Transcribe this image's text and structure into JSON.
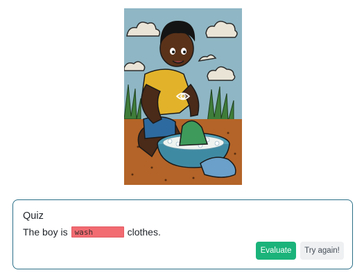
{
  "illustration": {
    "subject": "boy washing clothes in a basin",
    "overlay_icon": "eye-icon"
  },
  "quiz": {
    "title": "Quiz",
    "sentence_before": "The boy is",
    "answer_value": "wash",
    "sentence_after": "clothes.",
    "answer_state_color": "#f16b71",
    "evaluate_label": "Evaluate",
    "try_again_label": "Try again!",
    "accent_color": "#1bb37a",
    "border_color": "#2a6f87"
  }
}
